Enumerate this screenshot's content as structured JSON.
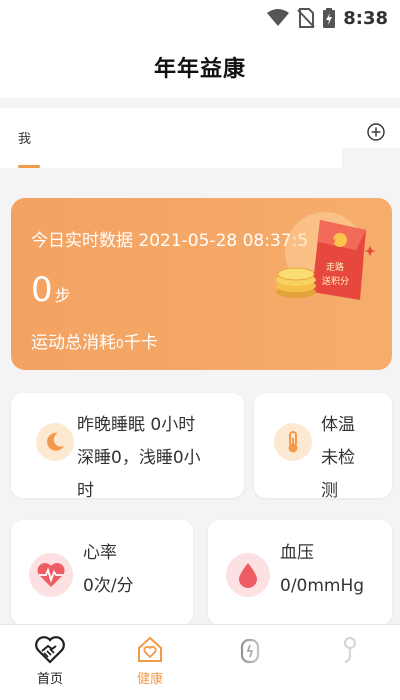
{
  "status_bar": {
    "time": "8:38",
    "icons": [
      "wifi-icon",
      "no-sim-icon",
      "battery-charging-icon"
    ]
  },
  "header": {
    "title": "年年益康"
  },
  "tabs": {
    "items": [
      {
        "label": "我"
      }
    ],
    "add_icon": "plus-circle-icon",
    "accent_color": "#f29a4b"
  },
  "realtime": {
    "title": "今日实时数据 2021-05-28 08:37:5",
    "steps_value": "0",
    "steps_unit": "步",
    "calories_prefix": "运动总消耗",
    "calories_value": "0",
    "calories_unit": "千卡",
    "reward_line1": "走路",
    "reward_line2": "送积分",
    "reward_icon": "red-envelope-coins-icon",
    "card_color": "#f4a261"
  },
  "cards": {
    "sleep": {
      "line1": "昨晚睡眠 0小时",
      "line2": "深睡0，浅睡0小",
      "line3": "时",
      "icon": "moon-icon"
    },
    "temperature": {
      "line1": "体温",
      "line2": "未检",
      "line3": "测",
      "icon": "thermometer-icon"
    },
    "heart_rate": {
      "line1": "心率",
      "line2": "0次/分",
      "icon": "heart-pulse-icon"
    },
    "blood_pressure": {
      "line1": "血压",
      "line2": "0/0mmHg",
      "icon": "blood-drop-icon"
    }
  },
  "bottom_nav": {
    "items": [
      {
        "label": "首页",
        "icon": "heart-handshake-icon"
      },
      {
        "label": "健康",
        "icon": "health-house-icon",
        "active": true
      },
      {
        "label": "",
        "icon": "watch-icon"
      },
      {
        "label": "",
        "icon": "person-icon"
      }
    ]
  }
}
